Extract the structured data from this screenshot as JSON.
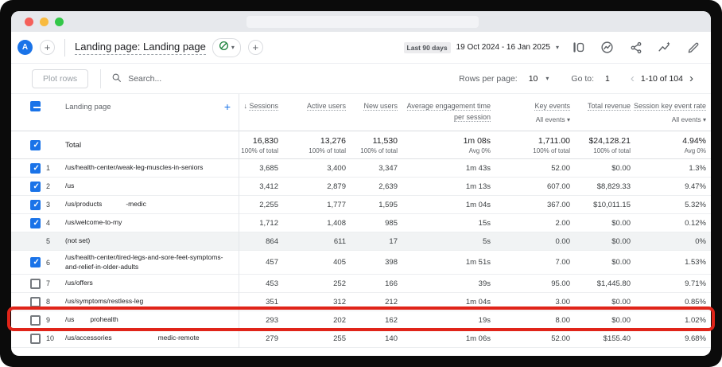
{
  "header": {
    "avatar_letter": "A",
    "tab_title": "Landing page: Landing page",
    "date_range_label": "Last 90 days",
    "date_range": "19 Oct 2024 - 16 Jan 2025",
    "icons": [
      "compare-panels-icon",
      "insights-icon",
      "share-icon",
      "trend-sparkle-icon",
      "edit-icon"
    ],
    "accent_color": "#1a73e8",
    "status_icon_color": "#188038"
  },
  "toolbar": {
    "plot_rows_label": "Plot rows",
    "search_placeholder": "Search...",
    "rows_per_page_label": "Rows per page:",
    "rows_per_page_value": "10",
    "goto_label": "Go to:",
    "goto_value": "1",
    "pagination_text": "1-10 of 104"
  },
  "table": {
    "dimension_header": "Landing page",
    "columns": [
      {
        "label": "Sessions",
        "sorted": "desc"
      },
      {
        "label": "Active users"
      },
      {
        "label": "New users"
      },
      {
        "label": "Average engagement time per session"
      },
      {
        "label": "Key events",
        "filter": "All events"
      },
      {
        "label": "Total revenue"
      },
      {
        "label": "Session key event rate",
        "filter": "All events"
      }
    ],
    "total": {
      "label": "Total",
      "values": [
        {
          "v": "16,830",
          "s": "100% of total"
        },
        {
          "v": "13,276",
          "s": "100% of total"
        },
        {
          "v": "11,530",
          "s": "100% of total"
        },
        {
          "v": "1m 08s",
          "s": "Avg 0%"
        },
        {
          "v": "1,711.00",
          "s": "100% of total"
        },
        {
          "v": "$24,128.21",
          "s": "100% of total"
        },
        {
          "v": "4.94%",
          "s": "Avg 0%"
        }
      ]
    },
    "rows": [
      {
        "n": "1",
        "cb": "checked",
        "parts": [
          {
            "t": "/us/health-center/weak-leg-muscles-in-seniors"
          }
        ],
        "v": [
          "3,685",
          "3,400",
          "3,347",
          "1m 43s",
          "52.00",
          "$0.00",
          "1.3%"
        ]
      },
      {
        "n": "2",
        "cb": "checked",
        "parts": [
          {
            "t": "/us"
          }
        ],
        "v": [
          "3,412",
          "2,879",
          "2,639",
          "1m 13s",
          "607.00",
          "$8,829.33",
          "9.47%"
        ]
      },
      {
        "n": "3",
        "cb": "checked",
        "parts": [
          {
            "t": "/us/products"
          },
          {
            "gap": 30
          },
          {
            "t": "-medic"
          }
        ],
        "v": [
          "2,255",
          "1,777",
          "1,595",
          "1m 04s",
          "367.00",
          "$10,011.15",
          "5.32%"
        ]
      },
      {
        "n": "4",
        "cb": "checked",
        "parts": [
          {
            "t": "/us/welcome-to-my"
          },
          {
            "gap": 26
          }
        ],
        "v": [
          "1,712",
          "1,408",
          "985",
          "15s",
          "2.00",
          "$0.00",
          "0.12%"
        ]
      },
      {
        "n": "5",
        "cb": "none",
        "muted": true,
        "parts": [
          {
            "t": "(not set)"
          }
        ],
        "v": [
          "864",
          "611",
          "17",
          "5s",
          "0.00",
          "$0.00",
          "0%"
        ]
      },
      {
        "n": "6",
        "cb": "checked",
        "tall": true,
        "parts": [
          {
            "t": "/us/health-center/tired-legs-and-sore-feet-symptoms-and-relief-in-older-adults"
          }
        ],
        "v": [
          "457",
          "405",
          "398",
          "1m 51s",
          "7.00",
          "$0.00",
          "1.53%"
        ]
      },
      {
        "n": "7",
        "cb": "unchecked",
        "parts": [
          {
            "t": "/us/offers"
          }
        ],
        "v": [
          "453",
          "252",
          "166",
          "39s",
          "95.00",
          "$1,445.80",
          "9.71%"
        ]
      },
      {
        "n": "8",
        "cb": "unchecked",
        "parts": [
          {
            "t": "/us/symptoms/restless-leg"
          }
        ],
        "v": [
          "351",
          "312",
          "212",
          "1m 04s",
          "3.00",
          "$0.00",
          "0.85%"
        ]
      },
      {
        "n": "9",
        "cb": "unchecked",
        "highlighted": true,
        "parts": [
          {
            "t": "/us"
          },
          {
            "gap": 20
          },
          {
            "t": "prohealth"
          }
        ],
        "v": [
          "293",
          "202",
          "162",
          "19s",
          "8.00",
          "$0.00",
          "1.02%"
        ]
      },
      {
        "n": "10",
        "cb": "unchecked",
        "parts": [
          {
            "t": "/us/accessories"
          },
          {
            "gap": 58
          },
          {
            "t": "medic-remote"
          }
        ],
        "v": [
          "279",
          "255",
          "140",
          "1m 06s",
          "52.00",
          "$155.40",
          "9.68%"
        ]
      }
    ]
  },
  "annotation": {
    "type": "red-highlight-box",
    "target": "row-9",
    "color": "#e02419"
  }
}
